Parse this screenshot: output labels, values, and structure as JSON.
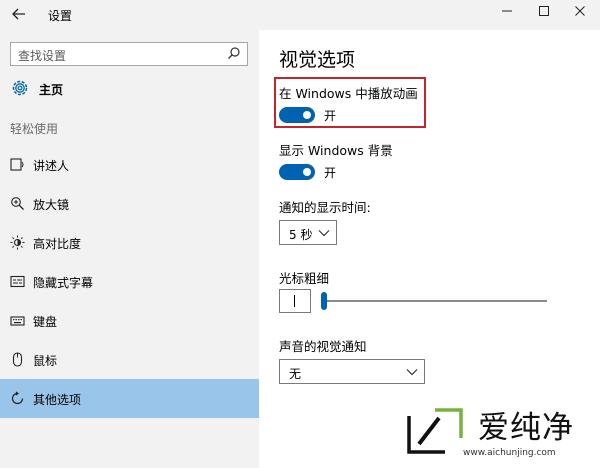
{
  "window": {
    "title": "设置"
  },
  "sidebar": {
    "search_placeholder": "查找设置",
    "home_label": "主页",
    "section_label": "轻松使用",
    "items": [
      {
        "label": "讲述人",
        "icon": "narrator-icon"
      },
      {
        "label": "放大镜",
        "icon": "magnifier-icon"
      },
      {
        "label": "高对比度",
        "icon": "high-contrast-icon"
      },
      {
        "label": "隐藏式字幕",
        "icon": "closed-captions-icon"
      },
      {
        "label": "键盘",
        "icon": "keyboard-icon"
      },
      {
        "label": "鼠标",
        "icon": "mouse-icon"
      },
      {
        "label": "其他选项",
        "icon": "other-options-icon",
        "selected": true
      }
    ]
  },
  "main": {
    "heading": "视觉选项",
    "play_animations": {
      "label": "在 Windows 中播放动画",
      "state": "开",
      "on": true
    },
    "show_background": {
      "label": "显示 Windows 背景",
      "state": "开",
      "on": true
    },
    "notification_time": {
      "label": "通知的显示时间:",
      "value": "5 秒"
    },
    "cursor_thickness": {
      "label": "光标粗细",
      "level": 0
    },
    "visual_notifications": {
      "label": "声音的视觉通知",
      "value": "无"
    }
  },
  "watermark": {
    "text": "爱纯净",
    "url": "www.aichunjing.com"
  },
  "colors": {
    "accent": "#0063b1",
    "selected": "#9ac5ea",
    "highlight": "#c0262d",
    "sidebar_bg": "#f2f2f2"
  }
}
